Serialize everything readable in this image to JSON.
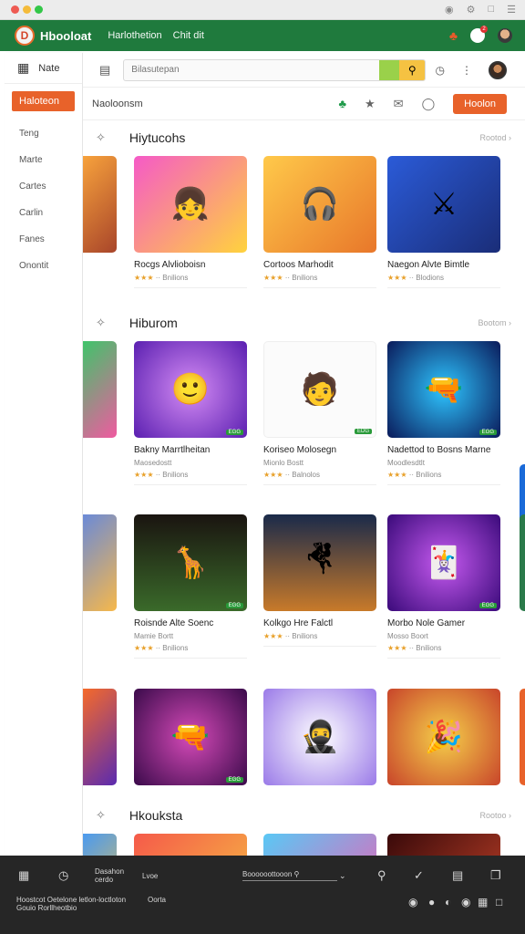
{
  "window": {
    "title": "Hbooloat",
    "dots": [
      "#ee5a52",
      "#f4bb3a",
      "#33c748"
    ]
  },
  "header": {
    "brand": "Hbooloat",
    "logo_letter": "D",
    "menu": [
      "Harlothetion",
      "Chit dit"
    ],
    "notif_count": "2"
  },
  "sidebar": {
    "top_label": "Nate",
    "active": "Haloteon",
    "items": [
      "Teng",
      "Marte",
      "Cartes",
      "Carlin",
      "Fanes",
      "Onontit"
    ]
  },
  "topbar": {
    "search_placeholder": "Bilasutepan"
  },
  "subbar": {
    "label": "Naoloonsm",
    "cta": "Hoolon"
  },
  "sections": [
    {
      "title": "Hiytucohs",
      "more": "Rootod",
      "cards": [
        {
          "title": "Rocgs Alvlioboisn",
          "meta": "·· Bnilions",
          "stars": "★★★"
        },
        {
          "title": "Cortoos Marhodit",
          "meta": "·· Bnilions",
          "stars": "★★★"
        },
        {
          "title": "Naegon Alvte Bimtle",
          "meta": "·· Blodions",
          "stars": "★★★"
        }
      ]
    },
    {
      "title": "Hiburom",
      "more": "Bootom",
      "cards": [
        {
          "title": "Bakny Marrtlheitan",
          "sub": "Maosedostt",
          "meta": "·· Bnilions",
          "stars": "★★★",
          "tag": "EGG"
        },
        {
          "title": "Koriseo Molosegn",
          "sub": "Mionlo Bostt",
          "meta": "·· Balnolos",
          "stars": "★★★",
          "tag": "EDG"
        },
        {
          "title": "Nadettod to Bosns Marne",
          "sub": "Moodlesdtlt",
          "meta": "·· Bnilions",
          "stars": "★★★",
          "tag": "EGG"
        }
      ]
    },
    {
      "title": "",
      "more": "",
      "cards": [
        {
          "title": "Roisnde Alte Soenc",
          "sub": "Mamie Bortt",
          "meta": "·· Bnilions",
          "stars": "★★★",
          "tag": "EGG"
        },
        {
          "title": "Kolkgo Hre Falctl",
          "sub": "",
          "meta": "·· Bnilions",
          "stars": "★★★",
          "tag": ""
        },
        {
          "title": "Morbo Nole Gamer",
          "sub": "Mosso Boort",
          "meta": "·· Bnilions",
          "stars": "★★★",
          "tag": "EGG"
        }
      ]
    },
    {
      "title": "",
      "more": "",
      "cards": [
        {
          "title": "",
          "tag": "EGG"
        },
        {
          "title": "",
          "tag": ""
        },
        {
          "title": "",
          "tag": ""
        }
      ]
    },
    {
      "title": "Hkouksta",
      "more": "Rootoo"
    }
  ],
  "taskbar": {
    "items": [
      "Dasahon cerdo",
      "Lvoe",
      "Boooooottooon"
    ],
    "bottom_left": "Hoostcot Oetelone letlon-loctloton Gouio Rorllheotbio",
    "bottom_mid": "Oorta"
  }
}
